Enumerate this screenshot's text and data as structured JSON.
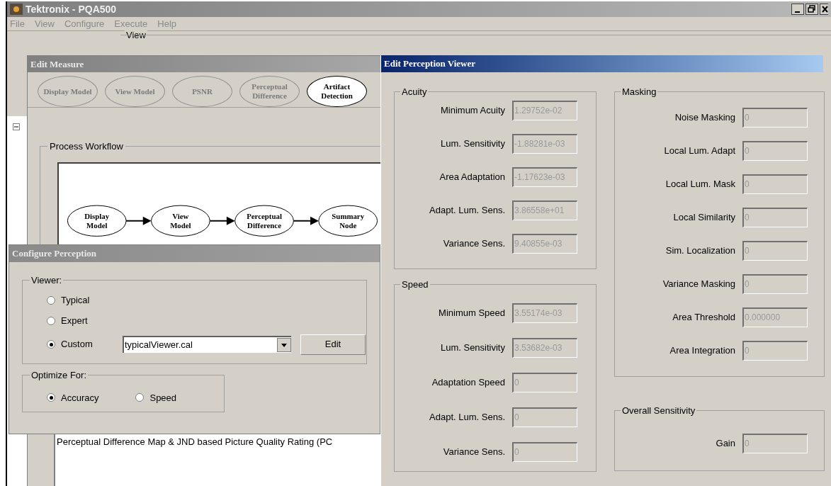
{
  "window": {
    "title": "Tektronix - PQA500"
  },
  "menu": [
    "File",
    "View",
    "Configure",
    "Execute",
    "Help"
  ],
  "view_group": {
    "label": "View"
  },
  "edit_measure": {
    "title": "Edit Measure",
    "steps": [
      {
        "label": "Display Model",
        "selected": false
      },
      {
        "label": "View Model",
        "selected": false
      },
      {
        "label": "PSNR",
        "selected": false
      },
      {
        "label": "Perceptual Difference",
        "selected": false
      },
      {
        "label": "Artifact Detection",
        "selected": true
      }
    ],
    "process_workflow": {
      "label": "Process Workflow",
      "nodes": [
        "Display Model",
        "View Model",
        "Perceptual Difference",
        "Summary Node"
      ]
    },
    "description": "Perceptual Difference Map & JND based Picture Quality Rating (PC"
  },
  "configure_perception": {
    "title": "Configure Perception",
    "viewer": {
      "label": "Viewer:",
      "options": [
        {
          "label": "Typical",
          "selected": false
        },
        {
          "label": "Expert",
          "selected": false
        },
        {
          "label": "Custom",
          "selected": true
        }
      ],
      "file": "typicalViewer.cal",
      "edit_button": "Edit"
    },
    "optimize_for": {
      "label": "Optimize For:",
      "options": [
        {
          "label": "Accuracy",
          "selected": true
        },
        {
          "label": "Speed",
          "selected": false
        }
      ]
    }
  },
  "edit_perception_viewer": {
    "title": "Edit Perception Viewer",
    "acuity": {
      "label": "Acuity",
      "fields": [
        {
          "label": "Minimum Acuity",
          "value": "1.29752e-02",
          "disabled": true
        },
        {
          "label": "Lum. Sensitivity",
          "value": "-1.88281e-03",
          "disabled": true
        },
        {
          "label": "Area Adaptation",
          "value": "-1.17623e-03",
          "disabled": true
        },
        {
          "label": "Adapt. Lum. Sens.",
          "value": "3.86558e+01",
          "disabled": true
        },
        {
          "label": "Variance Sens.",
          "value": "9.40855e-03",
          "disabled": true
        }
      ]
    },
    "speed": {
      "label": "Speed",
      "fields": [
        {
          "label": "Minimum Speed",
          "value": "3.55174e-03",
          "disabled": true
        },
        {
          "label": "Lum. Sensitivity",
          "value": "3.53682e-03",
          "disabled": true
        },
        {
          "label": "Adaptation Speed",
          "value": "0",
          "disabled": true
        },
        {
          "label": "Adapt. Lum. Sens.",
          "value": "0",
          "disabled": true
        },
        {
          "label": "Variance Sens.",
          "value": "0",
          "disabled": true
        }
      ]
    },
    "masking": {
      "label": "Masking",
      "fields": [
        {
          "label": "Noise Masking",
          "value": "0",
          "disabled": true
        },
        {
          "label": "Local Lum. Adapt",
          "value": "0",
          "disabled": true
        },
        {
          "label": "Local Lum. Mask",
          "value": "0",
          "disabled": true
        },
        {
          "label": "Local Similarity",
          "value": "0",
          "disabled": true
        },
        {
          "label": "Sim. Localization",
          "value": "0",
          "disabled": true
        },
        {
          "label": "Variance Masking",
          "value": "0",
          "disabled": true
        },
        {
          "label": "Area Threshold",
          "value": "0.000000",
          "disabled": true
        },
        {
          "label": "Area Integration",
          "value": "0",
          "disabled": true
        }
      ]
    },
    "overall_sensitivity": {
      "label": "Overall Sensitivity",
      "fields": [
        {
          "label": "Gain",
          "value": "0",
          "disabled": true
        }
      ]
    }
  }
}
